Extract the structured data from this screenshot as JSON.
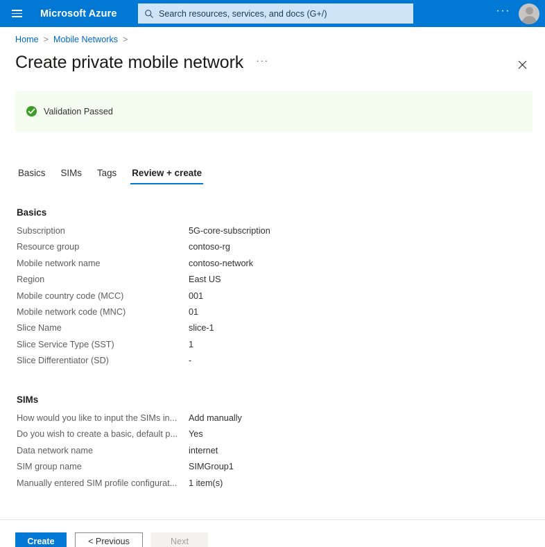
{
  "topbar": {
    "menu_icon": "hamburger-icon",
    "brand": "Microsoft Azure",
    "search": {
      "icon": "search-icon",
      "placeholder": "Search resources, services, and docs (G+/)",
      "value": ""
    },
    "more_label": "···",
    "account_icon": "user-avatar-icon",
    "brand_color": "#0078d4",
    "search_bg": "#cfe4f7"
  },
  "breadcrumb": {
    "items": [
      {
        "label": "Home",
        "separator": ">"
      },
      {
        "label": "Mobile Networks",
        "separator": ">"
      }
    ],
    "link_color": "#0066cc"
  },
  "header": {
    "title": "Create private mobile network",
    "more_label": "···",
    "close_icon": "close-icon"
  },
  "banner": {
    "icon": "validation-passed-check-icon",
    "text": "Validation Passed",
    "bg_color": "#f4fdf0",
    "icon_color": "#3a9e27"
  },
  "tabs": [
    {
      "label": "Basics",
      "active": false
    },
    {
      "label": "SIMs",
      "active": false
    },
    {
      "label": "Tags",
      "active": false
    },
    {
      "label": "Review + create",
      "active": true
    }
  ],
  "tab_accent_color": "#0078d4",
  "sections": [
    {
      "id": "basics",
      "title": "Basics",
      "rows": [
        {
          "key": "Subscription",
          "value": "5G-core-subscription"
        },
        {
          "key": "Resource group",
          "value": "contoso-rg"
        },
        {
          "key": "Mobile network name",
          "value": "contoso-network"
        },
        {
          "key": "Region",
          "value": "East US"
        },
        {
          "key": "Mobile country code (MCC)",
          "value": "001"
        },
        {
          "key": "Mobile network code (MNC)",
          "value": "01"
        },
        {
          "key": "Slice Name",
          "value": "slice-1"
        },
        {
          "key": "Slice Service Type (SST)",
          "value": "1"
        },
        {
          "key": "Slice Differentiator (SD)",
          "value": "-"
        }
      ]
    },
    {
      "id": "sims",
      "title": "SIMs",
      "rows": [
        {
          "key": "How would you like to input the SIMs in...",
          "value": "Add manually"
        },
        {
          "key": "Do you wish to create a basic, default p...",
          "value": "Yes"
        },
        {
          "key": "Data network name",
          "value": "internet"
        },
        {
          "key": "SIM group name",
          "value": "SIMGroup1"
        },
        {
          "key": "Manually entered SIM profile configurat...",
          "value": "1 item(s)"
        }
      ]
    }
  ],
  "footer": {
    "create_label": "Create",
    "previous_label": "< Previous",
    "next_label": "Next",
    "next_disabled": true,
    "primary_color": "#0078d4"
  }
}
